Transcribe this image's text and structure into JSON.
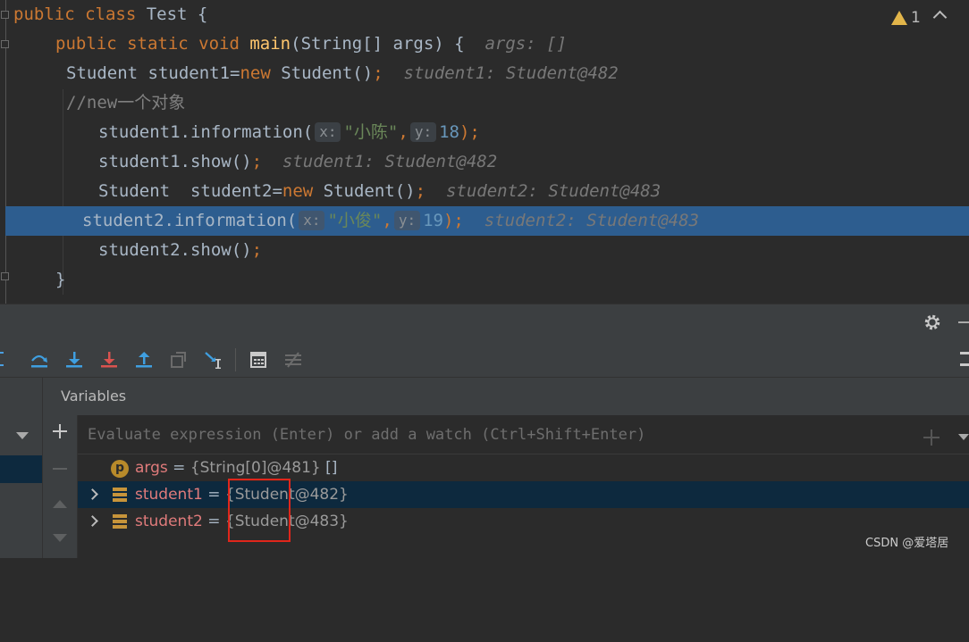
{
  "editor": {
    "lines": [
      {
        "segments": [
          {
            "t": "public ",
            "c": "kw"
          },
          {
            "t": "class ",
            "c": "kw"
          },
          {
            "t": "Test {",
            "c": "p"
          }
        ]
      },
      {
        "segments": [
          {
            "t": "public ",
            "c": "kw"
          },
          {
            "t": "static ",
            "c": "kw"
          },
          {
            "t": "void ",
            "c": "kw"
          },
          {
            "t": "main",
            "c": "fn"
          },
          {
            "t": "(String[] args) {",
            "c": "p"
          },
          {
            "t": "  args: []",
            "c": "hint"
          }
        ]
      },
      {
        "segments": [
          {
            "t": "Student student1=",
            "c": "p"
          },
          {
            "t": "new ",
            "c": "kw"
          },
          {
            "t": "Student()",
            "c": "p"
          },
          {
            "t": ";",
            "c": "kw"
          },
          {
            "t": "  student1: Student@482",
            "c": "hint"
          }
        ]
      },
      {
        "segments": [
          {
            "t": "//new一个对象",
            "c": "cmt"
          }
        ]
      },
      {
        "segments": [
          {
            "t": "student1.information(",
            "c": "p"
          },
          {
            "t": "x:",
            "c": "param"
          },
          {
            "t": "\"小陈\"",
            "c": "str"
          },
          {
            "t": ",",
            "c": "kw"
          },
          {
            "t": "y:",
            "c": "param"
          },
          {
            "t": "18",
            "c": "num"
          },
          {
            "t": ");",
            "c": "kw"
          }
        ]
      },
      {
        "segments": [
          {
            "t": "student1.show()",
            "c": "p"
          },
          {
            "t": ";",
            "c": "kw"
          },
          {
            "t": "  student1: Student@482",
            "c": "hint"
          }
        ]
      },
      {
        "segments": [
          {
            "t": "Student  student2=",
            "c": "p"
          },
          {
            "t": "new ",
            "c": "kw"
          },
          {
            "t": "Student()",
            "c": "p"
          },
          {
            "t": ";",
            "c": "kw"
          },
          {
            "t": "  student2: Student@483",
            "c": "hint"
          }
        ]
      },
      {
        "segments": [
          {
            "t": "student2.information(",
            "c": "p"
          },
          {
            "t": "x:",
            "c": "param"
          },
          {
            "t": "\"小俊\"",
            "c": "str"
          },
          {
            "t": ",",
            "c": "kw"
          },
          {
            "t": "y:",
            "c": "param"
          },
          {
            "t": "19",
            "c": "num"
          },
          {
            "t": ");",
            "c": "kw"
          },
          {
            "t": "  student2: Student@483",
            "c": "hint"
          }
        ]
      },
      {
        "segments": [
          {
            "t": "student2.show()",
            "c": "p"
          },
          {
            "t": ";",
            "c": "kw"
          }
        ]
      },
      {
        "segments": [
          {
            "t": "}",
            "c": "p"
          }
        ]
      }
    ],
    "warning_count": "1"
  },
  "debugger": {
    "variables_title": "Variables",
    "eval_placeholder": "Evaluate expression (Enter) or add a watch (Ctrl+Shift+Enter)",
    "variables": [
      {
        "badge": "p",
        "name": "args",
        "eq": " = ",
        "value": "{String[0]@481}",
        "extra": " []"
      },
      {
        "name": "student1",
        "eq": " = ",
        "value": "{Student@482}",
        "extra": ""
      },
      {
        "name": "student2",
        "eq": " = ",
        "value": "{Student@483}",
        "extra": ""
      }
    ]
  },
  "watermark": "CSDN @爱塔居",
  "colors": {
    "keyword": "#cc7832",
    "method": "#ffc66d",
    "string": "#6a8759",
    "number": "#6897bb",
    "current_line": "#2d5d8f",
    "highlight_box": "#e0261b"
  },
  "icons": [
    "warning-icon",
    "chevron-up-icon",
    "gear-icon",
    "step-over-icon",
    "step-into-icon",
    "force-step-into-icon",
    "step-out-icon",
    "drop-frame-icon",
    "run-to-cursor-icon",
    "evaluate-icon",
    "trace-icon",
    "add-watch-icon",
    "field-icon",
    "parameter-icon"
  ]
}
